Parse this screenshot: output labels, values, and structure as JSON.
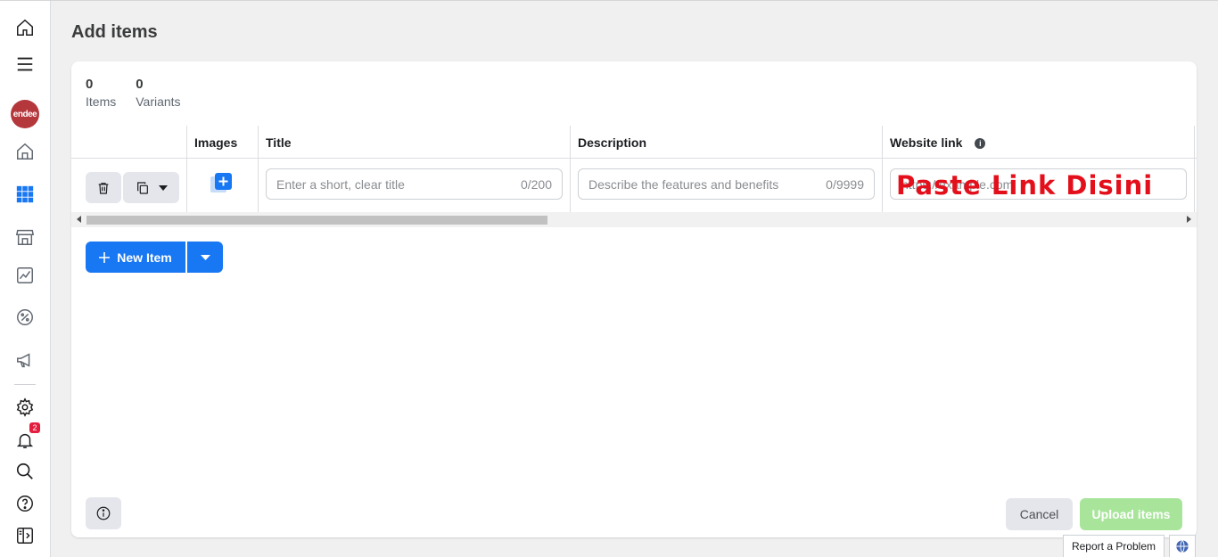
{
  "sidebar": {
    "items": [
      {
        "icon": "home-outline-icon"
      },
      {
        "icon": "menu-icon"
      },
      {
        "icon": "avatar",
        "label": "endee"
      },
      {
        "icon": "storefront-home-icon"
      },
      {
        "icon": "grid-icon"
      },
      {
        "icon": "shop-icon"
      },
      {
        "icon": "insights-icon"
      },
      {
        "icon": "discount-icon"
      },
      {
        "icon": "megaphone-icon"
      },
      {
        "icon": "gear-icon"
      },
      {
        "icon": "bell-icon",
        "badge": "2"
      },
      {
        "icon": "search-icon"
      },
      {
        "icon": "help-icon"
      },
      {
        "icon": "panel-toggle-icon"
      }
    ]
  },
  "page": {
    "title": "Add items"
  },
  "stats": {
    "items_count": "0",
    "items_label": "Items",
    "variants_count": "0",
    "variants_label": "Variants"
  },
  "table": {
    "headers": {
      "images": "Images",
      "title": "Title",
      "description": "Description",
      "website_link": "Website link"
    },
    "row": {
      "title_placeholder": "Enter a short, clear title",
      "title_counter": "0/200",
      "description_placeholder": "Describe the features and benefits",
      "description_counter": "0/9999",
      "website_placeholder": "https://example.com"
    }
  },
  "overlay_annotation": "Paste Link Disini",
  "actions": {
    "new_item": "New Item",
    "cancel": "Cancel",
    "upload": "Upload items",
    "report": "Report a Problem"
  },
  "colors": {
    "primary": "#1877f2",
    "upload_disabled": "#a8e59b",
    "annotation": "#e3101c",
    "avatar": "#b4373c"
  }
}
